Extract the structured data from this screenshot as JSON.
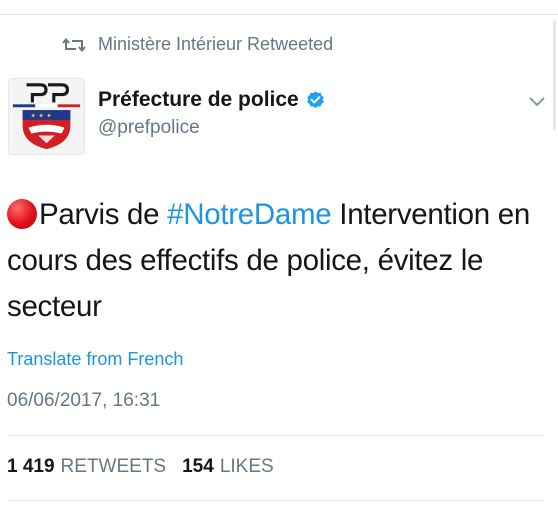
{
  "retweet": {
    "icon": "retweet-icon",
    "label": "Ministère Intérieur Retweeted"
  },
  "account": {
    "avatar_icon": "prefecture-de-police-logo",
    "name": "Préfecture de police",
    "verified_icon": "verified-badge-icon",
    "handle": "@prefpolice",
    "menu_icon": "chevron-down-icon"
  },
  "tweet": {
    "emoji": "red-circle",
    "text_part1": "Parvis de ",
    "hashtag": "#NotreDame",
    "text_part2": " Intervention en cours des effectifs de police, évitez le secteur"
  },
  "translate": {
    "label": "Translate from French"
  },
  "timestamp": "06/06/2017, 16:31",
  "stats": {
    "retweets_count": "1 419",
    "retweets_label": "RETWEETS",
    "likes_count": "154",
    "likes_label": "LIKES"
  },
  "colors": {
    "link": "#1b95e0",
    "secondary_text": "#657786",
    "divider": "#e1e8ed",
    "primary_text": "#14171a"
  }
}
